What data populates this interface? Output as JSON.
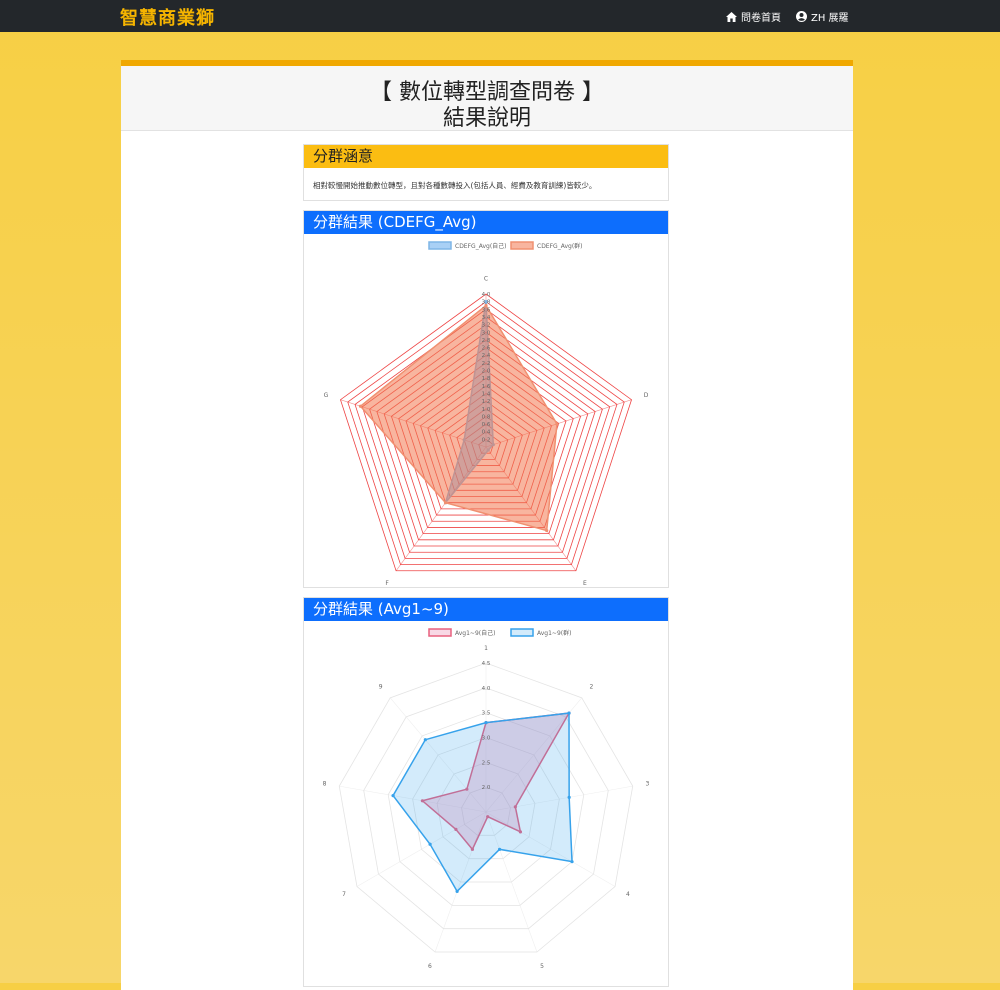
{
  "navbar": {
    "brand": "智慧商業獅",
    "home_label": "問卷首頁",
    "user_label": "ZH 展羅"
  },
  "header": {
    "title_line1": "【 數位轉型調查問卷 】",
    "title_line2": "結果說明"
  },
  "meaning_panel": {
    "title": "分群涵意",
    "text": "相對較慢開始推動數位轉型，且對各種數轉投入(包括人員、經費及教育訓練)皆較少。",
    "color": "#fbbd12"
  },
  "chart_panel_1": {
    "title": "分群結果 (CDEFG_Avg)",
    "color": "#0d6efd"
  },
  "chart_panel_2": {
    "title": "分群結果 (Avg1~9)",
    "color": "#0d6efd"
  },
  "chart_data": [
    {
      "type": "radar",
      "labels": [
        "C",
        "D",
        "E",
        "F",
        "G"
      ],
      "rlim": [
        0,
        4.0
      ],
      "tick_labels": [
        "0.2",
        "0.4",
        "0.6",
        "0.8",
        "1.0",
        "1.2",
        "1.4",
        "1.6",
        "1.8",
        "2.0",
        "2.2",
        "2.4",
        "2.6",
        "2.8",
        "3.0",
        "3.2",
        "3.4",
        "3.6",
        "3.8",
        "4.0"
      ],
      "legend_position": "top",
      "series": [
        {
          "name": "CDEFG_Avg(自己)",
          "values": [
            3.8,
            0.2,
            0.1,
            1.8,
            0.6
          ],
          "fill": "rgba(84,162,235,0.5)",
          "stroke": "#7fb5e6"
        },
        {
          "name": "CDEFG_Avg(群)",
          "values": [
            3.7,
            1.95,
            2.7,
            1.8,
            3.45
          ],
          "fill": "rgba(243,120,80,0.55)",
          "stroke": "#f09070"
        }
      ],
      "grid_color": "#ee4444"
    },
    {
      "type": "radar",
      "labels": [
        "1",
        "2",
        "3",
        "4",
        "5",
        "6",
        "7",
        "8",
        "9"
      ],
      "rlim": [
        1.5,
        4.5
      ],
      "tick_labels": [
        "2.0",
        "2.5",
        "3.0",
        "3.5",
        "4.0",
        "4.5"
      ],
      "legend_position": "top",
      "series": [
        {
          "name": "Avg1~9(自己)",
          "values": [
            3.3,
            4.1,
            2.1,
            2.3,
            1.6,
            2.3,
            2.2,
            2.8,
            2.1
          ],
          "fill": "rgba(226,100,150,0.25)",
          "stroke": "#e8607f"
        },
        {
          "name": "Avg1~9(群)",
          "values": [
            3.3,
            4.1,
            3.2,
            3.5,
            2.3,
            3.2,
            2.8,
            3.4,
            3.4
          ],
          "fill": "rgba(54,162,235,0.22)",
          "stroke": "#36a2eb"
        }
      ],
      "grid_color": "#e4e4e4"
    }
  ]
}
